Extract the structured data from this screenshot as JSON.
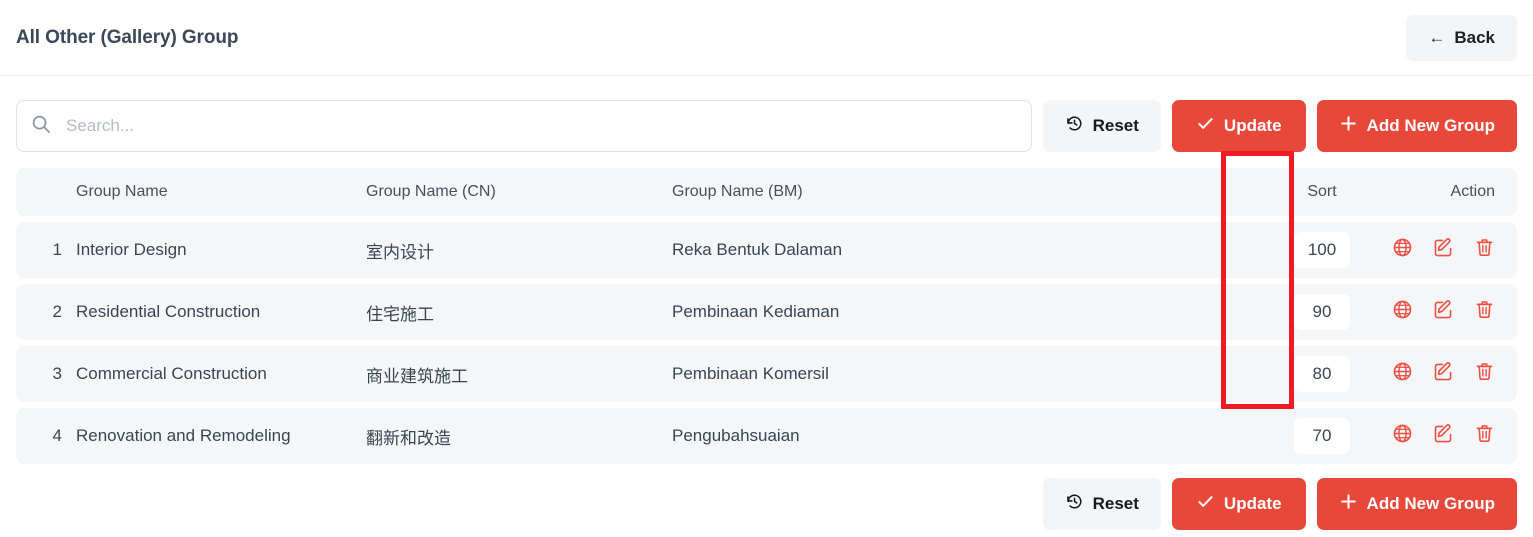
{
  "header": {
    "title": "All Other (Gallery) Group",
    "back_label": "Back",
    "back_icon": "arrow-left-icon"
  },
  "toolbar": {
    "search_placeholder": "Search...",
    "search_value": "",
    "search_icon": "search-icon",
    "reset_label": "Reset",
    "reset_icon": "history-clock-icon",
    "update_label": "Update",
    "update_icon": "check-icon",
    "add_label": "Add New Group",
    "add_icon": "plus-icon"
  },
  "table": {
    "columns": {
      "index": "",
      "name": "Group Name",
      "name_cn": "Group Name (CN)",
      "name_bm": "Group Name (BM)",
      "sort": "Sort",
      "action": "Action"
    },
    "rows": [
      {
        "index": "1",
        "name": "Interior Design",
        "name_cn": "室内设计",
        "name_bm": "Reka Bentuk Dalaman",
        "sort": "100"
      },
      {
        "index": "2",
        "name": "Residential Construction",
        "name_cn": "住宅施工",
        "name_bm": "Pembinaan Kediaman",
        "sort": "90"
      },
      {
        "index": "3",
        "name": "Commercial Construction",
        "name_cn": "商业建筑施工",
        "name_bm": "Pembinaan Komersil",
        "sort": "80"
      },
      {
        "index": "4",
        "name": "Renovation and Remodeling",
        "name_cn": "翻新和改造",
        "name_bm": "Pengubahsuaian",
        "sort": "70"
      }
    ],
    "action_icons": [
      "globe-icon",
      "edit-icon",
      "trash-icon"
    ]
  },
  "footer": {
    "reset_label": "Reset",
    "update_label": "Update",
    "add_label": "Add New Group"
  },
  "annotation": {
    "type": "highlight-rectangle",
    "target": "sort-column",
    "color": "#ed1c24"
  },
  "colors": {
    "primary": "#e8483a",
    "icon_red": "#ec5044",
    "row_bg": "#f5f6f8",
    "button_muted": "#f4f5f7",
    "text": "#3a4553"
  }
}
